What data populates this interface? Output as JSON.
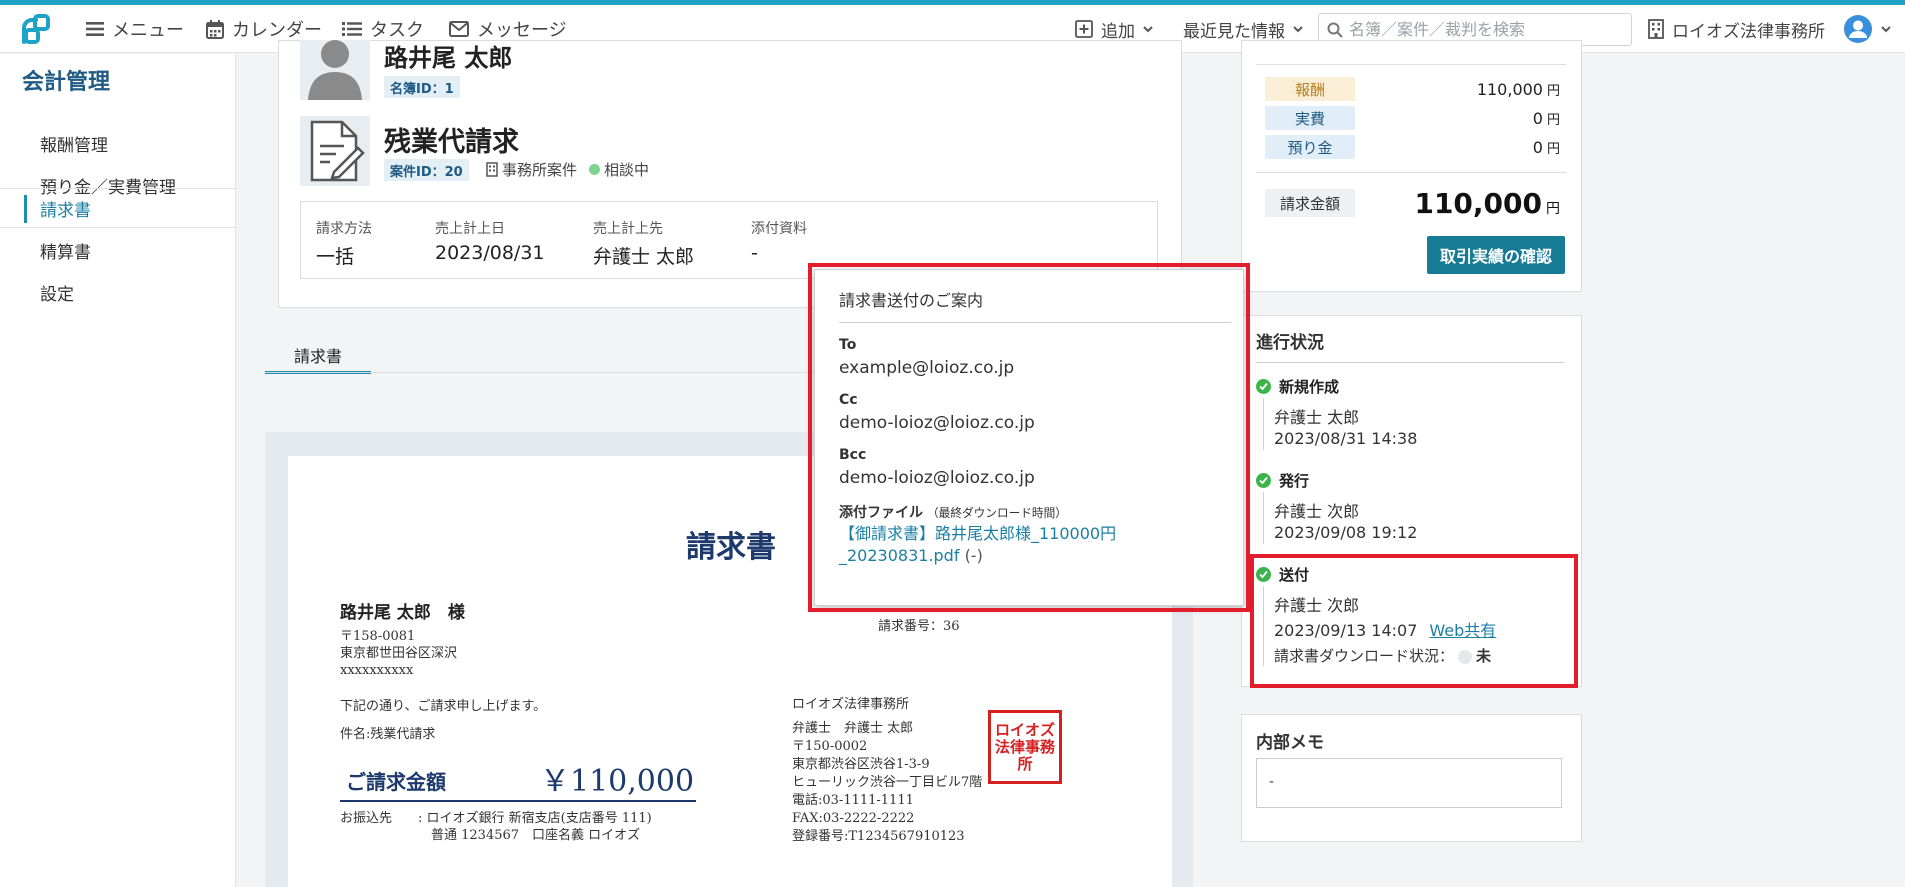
{
  "topbar": {
    "nav": [
      {
        "label": "メニュー",
        "icon": "menu-icon"
      },
      {
        "label": "カレンダー",
        "icon": "calendar-icon"
      },
      {
        "label": "タスク",
        "icon": "task-list-icon"
      },
      {
        "label": "メッセージ",
        "icon": "mail-icon"
      }
    ],
    "add_label": "追加",
    "recent_label": "最近見た情報",
    "search_placeholder": "名簿／案件／裁判を検索",
    "office_label": "ロイオズ法律事務所",
    "accent_color": "#1ea2c7"
  },
  "sidebar": {
    "title": "会計管理",
    "items": [
      {
        "label": "報酬管理"
      },
      {
        "label": "預り金／実費管理"
      },
      {
        "label": "請求書"
      },
      {
        "label": "精算書"
      },
      {
        "label": "設定"
      }
    ],
    "active_index": 2
  },
  "case": {
    "client_name": "路井尾 太郎",
    "client_badge": "名簿ID：1",
    "case_title": "残業代請求",
    "case_badge": "案件ID：20",
    "case_type": "事務所案件",
    "case_status": "相談中",
    "info": [
      {
        "label": "請求方法",
        "value": "一括"
      },
      {
        "label": "売上計上日",
        "value": "2023/08/31"
      },
      {
        "label": "売上計上先",
        "value": "弁護士 太郎"
      },
      {
        "label": "添付資料",
        "value": "-"
      }
    ]
  },
  "tabs": [
    {
      "label": "請求書"
    }
  ],
  "invoice_doc": {
    "title": "請求書",
    "client": "路井尾 太郎　様",
    "client_addr": "〒158-0081\n東京都世田谷区深沢\nxxxxxxxxxx",
    "intro": "下記の通り、ご請求申し上げます。",
    "subject": "件名:残業代請求",
    "amount_label": "ご請求金額",
    "amount": "￥110,000",
    "bank": "お振込先　　: ロイオズ銀行 新宿支店(支店番号 111)\n　　　　　　　普通 1234567　口座名義 ロイオズ",
    "invoice_no": "請求番号：36",
    "issuer": "ロイオズ法律事務所",
    "issuer_detail": "弁護士　弁護士 太郎\n〒150-0002\n東京都渋谷区渋谷1-3-9\nヒューリック渋谷一丁目ビル7階\n電話:03-1111-1111\nFAX:03-2222-2222\n登録番号:T1234567910123",
    "seal_text": "ロイオズ法律事務所"
  },
  "summary": {
    "rows": [
      {
        "label": "報酬",
        "value": "110,000",
        "unit": "円",
        "color": "#fbeed7",
        "text_color": "#b8801f"
      },
      {
        "label": "実費",
        "value": "0",
        "unit": "円",
        "color": "#e1eef8",
        "text_color": "#1e5a84"
      },
      {
        "label": "預り金",
        "value": "0",
        "unit": "円",
        "color": "#e1eef8",
        "text_color": "#1e5a84"
      }
    ],
    "total_label": "請求金額",
    "total_value": "110,000",
    "total_unit": "円",
    "confirm_button": "取引実績の確認"
  },
  "progress": {
    "title": "進行状況",
    "steps": [
      {
        "label": "新規作成",
        "person": "弁護士 太郎",
        "datetime": "2023/08/31 14:38"
      },
      {
        "label": "発行",
        "person": "弁護士 次郎",
        "datetime": "2023/09/08 19:12"
      },
      {
        "label": "送付",
        "person": "弁護士 次郎",
        "datetime": "2023/09/13 14:07",
        "link": "Web共有",
        "dl_label": "請求書ダウンロード状況：",
        "dl_value": "未"
      }
    ]
  },
  "memo": {
    "title": "内部メモ",
    "value": "-"
  },
  "popup": {
    "title": "請求書送付のご案内",
    "to_label": "To",
    "to_value": "example@loioz.co.jp",
    "cc_label": "Cc",
    "cc_value": "demo-loioz@loioz.co.jp",
    "bcc_label": "Bcc",
    "bcc_value": "demo-loioz@loioz.co.jp",
    "attach_label": "添付ファイル",
    "attach_note": "（最終ダウンロード時間）",
    "attach_file": "【御請求書】路井尾太郎様_110000円_20230831.pdf",
    "attach_time": "(-)",
    "highlight_color": "#e21e2d"
  }
}
